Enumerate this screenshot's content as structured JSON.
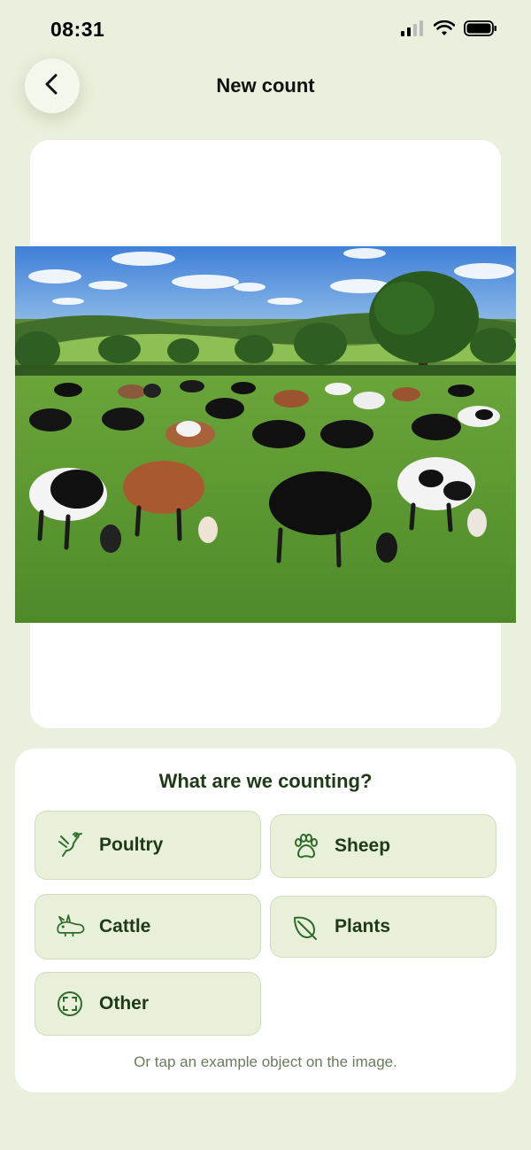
{
  "status_bar": {
    "time": "08:31"
  },
  "header": {
    "title": "New count",
    "back_icon": "chevron-left-icon"
  },
  "photo": {
    "subject": "cattle-herd-grazing"
  },
  "panel": {
    "question": "What are we counting?",
    "options": [
      {
        "label": "Poultry",
        "icon": "bird-icon"
      },
      {
        "label": "Sheep",
        "icon": "paw-icon"
      },
      {
        "label": "Cattle",
        "icon": "rabbit-icon"
      },
      {
        "label": "Plants",
        "icon": "leaf-icon"
      },
      {
        "label": "Other",
        "icon": "focus-frame-icon"
      }
    ],
    "hint": "Or tap an example object on the image."
  },
  "colors": {
    "background": "#e9f0dd",
    "option_fill": "#e8f0da",
    "accent_green": "#2e6b2a",
    "text_dark": "#1e3a16"
  }
}
